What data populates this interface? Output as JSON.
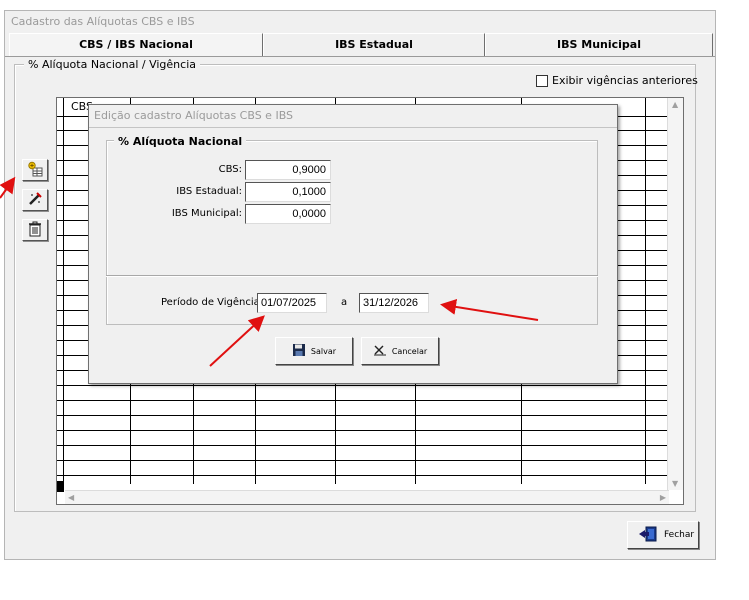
{
  "window": {
    "title": "Cadastro das Alíquotas CBS e IBS"
  },
  "tabs": [
    {
      "label": "CBS / IBS Nacional",
      "active": true
    },
    {
      "label": "IBS Estadual",
      "active": false
    },
    {
      "label": "IBS Municipal",
      "active": false
    }
  ],
  "group": {
    "label": "% Alíquota Nacional / Vigência"
  },
  "checkbox": {
    "label": "Exibir vigências anteriores",
    "checked": false
  },
  "side_toolbar": {
    "icons": [
      "add-record-icon",
      "edit-record-icon",
      "delete-trash-icon"
    ]
  },
  "grid": {
    "first_column_header": "CBS"
  },
  "footer": {
    "close_label": "Fechar"
  },
  "dialog": {
    "title": "Edição cadastro Alíquotas CBS e IBS",
    "group_label": "% Alíquota Nacional",
    "fields": [
      {
        "label": "CBS:",
        "value": "0,9000"
      },
      {
        "label": "IBS Estadual:",
        "value": "0,1000"
      },
      {
        "label": "IBS Municipal:",
        "value": "0,0000"
      }
    ],
    "period": {
      "label": "Período de Vigência:",
      "start": "01/07/2025",
      "separator": "a",
      "end": "31/12/2026"
    },
    "save_label": "Salvar",
    "cancel_label": "Cancelar"
  },
  "colors": {
    "window_bg": "#f0f0f0",
    "annotation_arrow": "#e01010"
  }
}
